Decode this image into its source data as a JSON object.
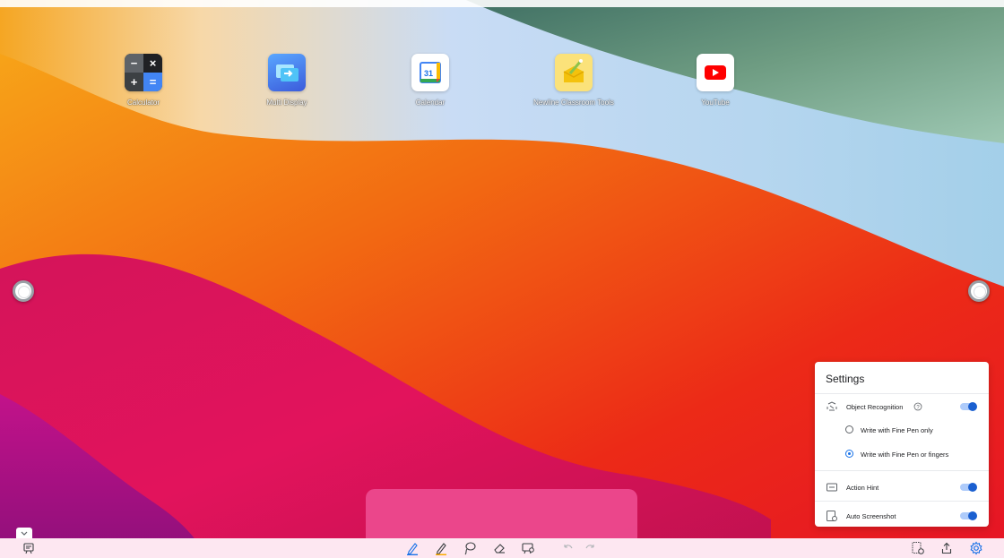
{
  "desktop": {
    "apps": [
      {
        "label": "Calculator",
        "icon": "calculator-icon"
      },
      {
        "label": "Multi Display",
        "icon": "multi-display-icon"
      },
      {
        "label": "Calendar",
        "icon": "calendar-icon",
        "day": "31"
      },
      {
        "label": "Newline Classroom Tools",
        "icon": "classroom-tools-icon"
      },
      {
        "label": "YouTube",
        "icon": "youtube-icon"
      }
    ]
  },
  "settings": {
    "title": "Settings",
    "object_recognition": {
      "label": "Object Recognition",
      "enabled": true
    },
    "options": [
      {
        "label": "Write with Fine Pen only",
        "selected": false
      },
      {
        "label": "Write with Fine Pen or fingers",
        "selected": true
      }
    ],
    "action_hint": {
      "label": "Action Hint",
      "enabled": true
    },
    "auto_screenshot": {
      "label": "Auto Screenshot",
      "enabled": true
    }
  },
  "toolbar": {
    "tools": [
      "pen-icon",
      "highlighter-icon",
      "lasso-icon",
      "eraser-icon",
      "screenshot-icon",
      "undo-icon",
      "redo-icon"
    ],
    "right": [
      "capture-icon",
      "share-icon",
      "settings-gear-icon"
    ]
  },
  "colors": {
    "accent": "#1a73e8",
    "pen_active": "#1a73e8",
    "highlighter": "#f9ab00",
    "bottom_bar": "#fde7f1",
    "panel": "#ec4a8e"
  }
}
